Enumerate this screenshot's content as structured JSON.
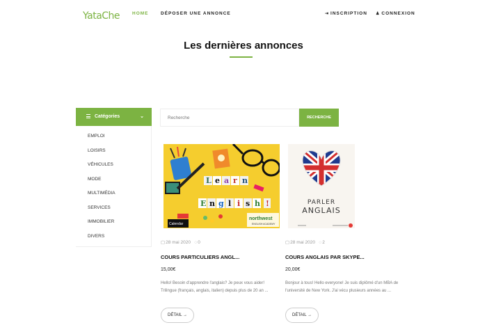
{
  "brand": {
    "logo": "YataChe"
  },
  "nav": {
    "home": "HOME",
    "post_ad": "DÉPOSER UNE ANNONCE",
    "register": "INSCRIPTION",
    "login": "CONNEXION"
  },
  "page": {
    "title": "Les dernières annonces"
  },
  "sidebar": {
    "header": "Catégories",
    "categories": [
      "EMPLOI",
      "LOISIRS",
      "VÉHICULES",
      "MODE",
      "MULTIMÉDIA",
      "SERVICES",
      "IMMOBILIER",
      "DIVERS"
    ]
  },
  "search": {
    "placeholder": "Recherche",
    "button": "RECHERCHE"
  },
  "listings": [
    {
      "date": "28 mai 2020",
      "comments": "0",
      "title": "COURS PARTICULIERS ANGL...",
      "price": "15,00€",
      "description": "Hello! Besoin d'apprendre l'anglais? Je peux vous aider! Trilingue (français, anglais, italien) depuis plus de 20 an ...",
      "detail": "DÉTAIL →",
      "image_text": {
        "line1": "Learn",
        "line2": "English !",
        "brand": "northwest",
        "stamp": "Calendar"
      }
    },
    {
      "date": "28 mai 2020",
      "comments": "2",
      "title": "COURS ANGLAIS PAR SKYPE...",
      "price": "20,00€",
      "description": "Bonjour à tous! Hello everyone! Je suis diplômé d'un MBA de l'université de New York. J'ai vécu plusieurs années au ...",
      "detail": "DÉTAIL →",
      "image_text": {
        "line1": "PARLER",
        "line2": "ANGLAIS"
      }
    }
  ],
  "colors": {
    "accent": "#7cb342",
    "text": "#222222",
    "muted": "#777777"
  }
}
